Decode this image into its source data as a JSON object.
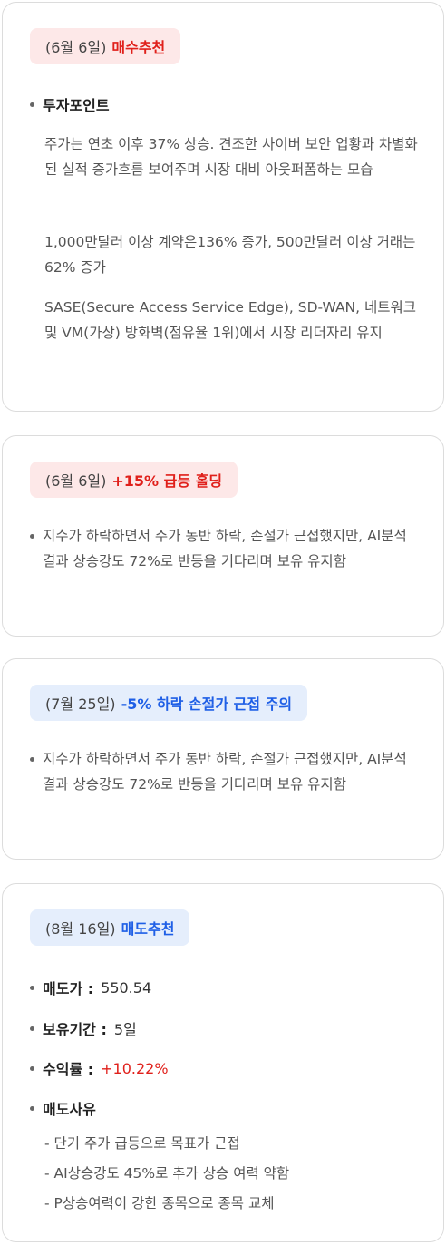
{
  "card1": {
    "badge_date": "(6월 6일)",
    "badge_action": "매수추천",
    "point_title": "투자포인트",
    "p1": "주가는 연초 이후 37%  상승. 견조한 사이버 보안 업황과 차별화된 실적 증가흐름 보여주며 시장 대비 아웃퍼폼하는 모습",
    "p2": "1,000만달러 이상 계약은136% 증가, 500만달러 이상 거래는 62%  증가",
    "p3": "SASE(Secure Access Service Edge), SD-WAN, 네트워크 및 VM(가상) 방화벽(점유율 1위)에서 시장 리더자리 유지"
  },
  "card2": {
    "badge_date": "(6월 6일)",
    "badge_action": "+15% 급등  홀딩",
    "text": "지수가 하락하면서 주가 동반 하락, 손절가 근접했지만, AI분석 결과 상승강도 72%로 반등을 기다리며 보유 유지함"
  },
  "card3": {
    "badge_date": "(7월 25일)",
    "badge_action": "-5% 하락  손절가 근접 주의",
    "text": "지수가 하락하면서 주가 동반 하락, 손절가 근접했지만, AI분석 결과 상승강도 72%로 반등을 기다리며 보유 유지함"
  },
  "card4": {
    "badge_date": "(8월 16일)",
    "badge_action": "매도추천",
    "sell_price_label": "매도가 :",
    "sell_price_value": "550.54",
    "hold_label": "보유기간 :",
    "hold_value": "5일",
    "return_label": "수익률 :",
    "return_value": "+10.22%",
    "reason_title": "매도사유",
    "reasons": [
      "- 단기 주가 급등으로 목표가 근접",
      "- AI상승강도 45%로  추가 상승 여력 약함",
      "- P상승여력이 강한 종목으로 종목 교체"
    ]
  },
  "colors": {
    "red": "#e0201b",
    "blue": "#1f5fe6",
    "badge_red_bg": "#fde8e8",
    "badge_blue_bg": "#e5eefc"
  }
}
